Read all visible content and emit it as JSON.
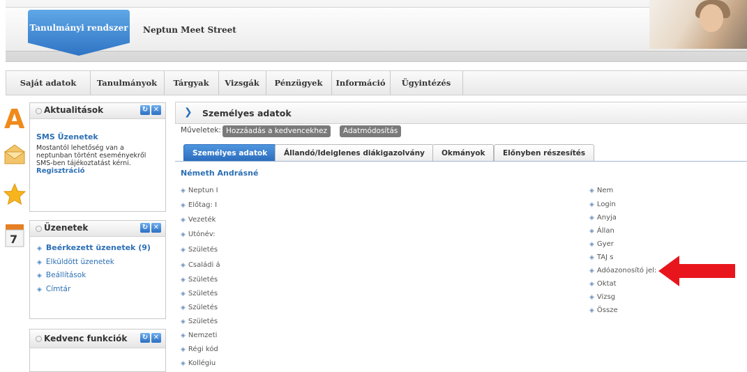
{
  "header": {
    "system_tab": "Tanulmányi rendszer",
    "meet_street": "Neptun Meet Street"
  },
  "menu": {
    "items": [
      "Saját adatok",
      "Tanulmányok",
      "Tárgyak",
      "Vizsgák",
      "Pénzügyek",
      "Információ",
      "Ügyintézés"
    ]
  },
  "panels": {
    "news": {
      "title": "Aktualitások",
      "sms_title": "SMS Üzenetek",
      "sms_text_1": "Mostantól lehetőség van a",
      "sms_text_2": "neptunban történt eseményekről",
      "sms_text_3": "SMS-ben tájékoztatást kérni.",
      "register_link": "Regisztráció"
    },
    "messages": {
      "title": "Üzenetek",
      "items": [
        "Beérkezett üzenetek (9)",
        "Elküldött üzenetek",
        "Beállítások",
        "Címtár"
      ]
    },
    "favorites": {
      "title": "Kedvenc funkciók"
    }
  },
  "main": {
    "title": "Személyes adatok",
    "operations_label": "Műveletek:",
    "op_add_favorite": "Hozzáadás a kedvencekhez",
    "op_modify": "Adatmódosítás",
    "tabs": [
      "Személyes adatok",
      "Állandó/Ideiglenes diákigazolvány",
      "Okmányok",
      "Előnyben részesítés"
    ],
    "student_name": "Németh Andrásné",
    "left_fields": [
      "Neptun I",
      "Előtag: I",
      "Vezeték",
      "Utónév:",
      "Születés",
      "Családi á",
      "Születés",
      "Születés",
      "Születés",
      "Születés",
      "Nemzeti",
      "Régi kód",
      "Kollégiu"
    ],
    "right_fields": [
      "Nem",
      "Login",
      "Anyja",
      "Állan",
      "Gyer",
      "TAJ s",
      "Adóazonosító jel:",
      "Oktat",
      "Vizsg",
      "Össze"
    ]
  },
  "colors": {
    "accent_blue": "#2d6fb5",
    "annotation_red": "#e8161c"
  }
}
